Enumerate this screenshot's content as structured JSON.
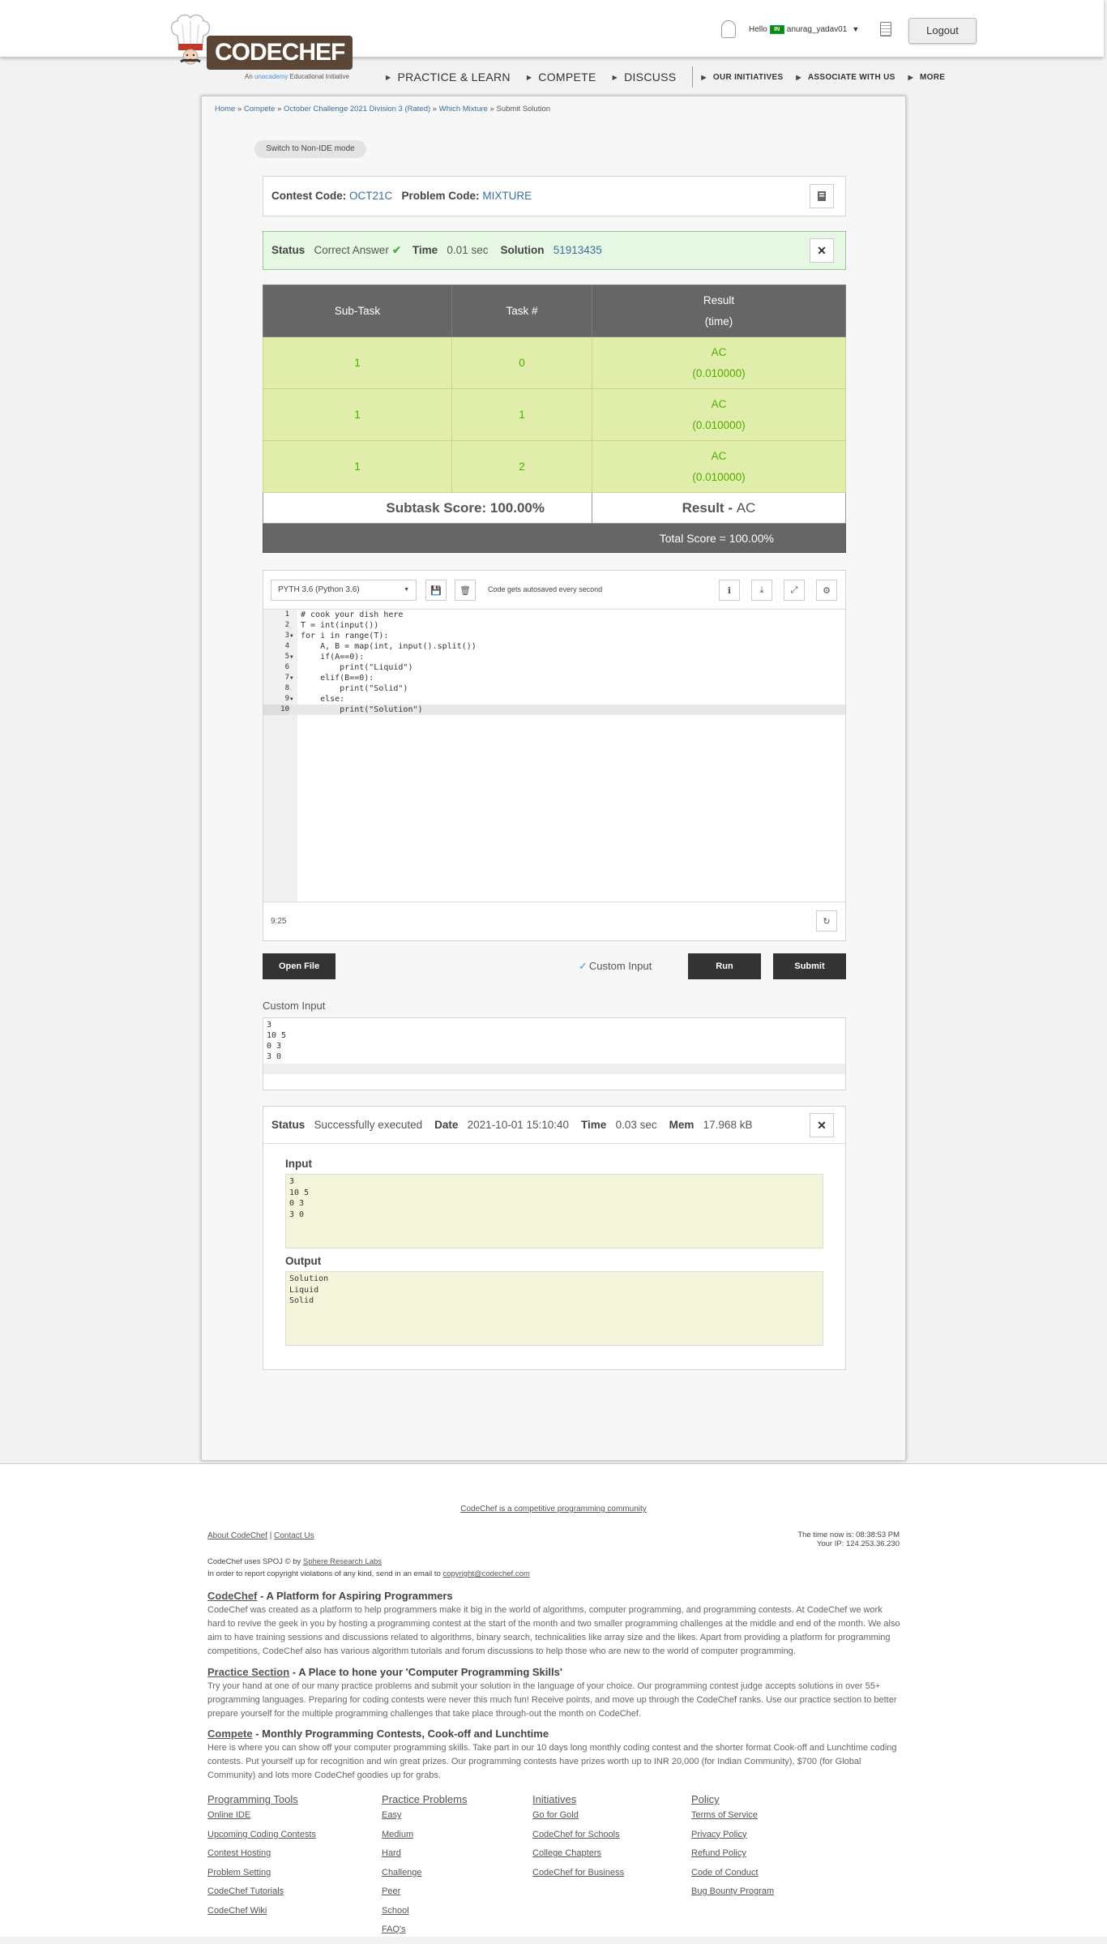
{
  "header": {
    "logo_text": "CODECHEF",
    "logo_tagline_prefix": "An",
    "logo_tagline_brand": "unacademy",
    "logo_tagline_suffix": "Educational Initiative",
    "greeting": "Hello",
    "flag": "IN",
    "username": "anurag_yadav01",
    "logout": "Logout"
  },
  "nav": {
    "items": [
      "PRACTICE & LEARN",
      "COMPETE",
      "DISCUSS"
    ],
    "small_items": [
      "OUR INITIATIVES",
      "ASSOCIATE WITH US",
      "MORE"
    ]
  },
  "breadcrumb": [
    "Home",
    "Compete",
    "October Challenge 2021 Division 3 (Rated)",
    "Which Mixture",
    "Submit Solution"
  ],
  "switch_mode": "Switch to Non-IDE mode",
  "problem": {
    "contest_label": "Contest Code:",
    "contest_code": "OCT21C",
    "problem_label": "Problem Code:",
    "problem_code": "MIXTURE"
  },
  "submission_status": {
    "status_label": "Status",
    "status": "Correct Answer",
    "time_label": "Time",
    "time": "0.01 sec",
    "solution_label": "Solution",
    "solution_id": "51913435"
  },
  "results": {
    "headers": [
      "Sub-Task",
      "Task #",
      "Result",
      "(time)"
    ],
    "rows": [
      {
        "subtask": "1",
        "task": "0",
        "result": "AC",
        "time": "(0.010000)"
      },
      {
        "subtask": "1",
        "task": "1",
        "result": "AC",
        "time": "(0.010000)"
      },
      {
        "subtask": "1",
        "task": "2",
        "result": "AC",
        "time": "(0.010000)"
      }
    ],
    "subtask_score": "Subtask Score: 100.00%",
    "result_label": "Result -",
    "result_value": "AC",
    "total_score": "Total Score = 100.00%"
  },
  "editor": {
    "language": "PYTH 3.6 (Python 3.6)",
    "autosave": "Code gets autosaved every second",
    "cursor_pos": "9:25",
    "lines": [
      "# cook your dish here",
      "T = int(input())",
      "for i in range(T):",
      "    A, B = map(int, input().split())",
      "    if(A==0):",
      "        print(\"Liquid\")",
      "    elif(B==0):",
      "        print(\"Solid\")",
      "    else:",
      "        print(\"Solution\")"
    ]
  },
  "actions": {
    "open_file": "Open File",
    "custom_input": "Custom Input",
    "run": "Run",
    "submit": "Submit"
  },
  "custom_input": {
    "label": "Custom Input",
    "value": "3\n10 5\n0 3\n3 0\n"
  },
  "run_result": {
    "status_label": "Status",
    "status": "Successfully executed",
    "date_label": "Date",
    "date": "2021-10-01 15:10:40",
    "time_label": "Time",
    "time": "0.03 sec",
    "mem_label": "Mem",
    "mem": "17.968 kB",
    "input_label": "Input",
    "input": "3\n10 5\n0 3\n3 0",
    "output_label": "Output",
    "output": "Solution\nLiquid\nSolid"
  },
  "footer": {
    "tagline": "CodeChef is a competitive programming community",
    "about": "About CodeChef",
    "contact": "Contact Us",
    "time_now": "The time now is: 08:38:53 PM",
    "your_ip": "Your IP: 124.253.36.230",
    "spoj_prefix": "CodeChef uses SPOJ © by",
    "spoj_link": "Sphere Research Labs",
    "copyright_prefix": "In order to report copyright violations of any kind, send in an email to",
    "copyright_email": "copyright@codechef.com",
    "sections": [
      {
        "title_link": "CodeChef",
        "title_rest": " - A Platform for Aspiring Programmers",
        "text": "CodeChef was created as a platform to help programmers make it big in the world of algorithms, computer programming, and programming contests. At CodeChef we work hard to revive the geek in you by hosting a programming contest at the start of the month and two smaller programming challenges at the middle and end of the month. We also aim to have training sessions and discussions related to algorithms, binary search, technicalities like array size and the likes. Apart from providing a platform for programming competitions, CodeChef also has various algorithm tutorials and forum discussions to help those who are new to the world of computer programming."
      },
      {
        "title_link": "Practice Section",
        "title_rest": " - A Place to hone your 'Computer Programming Skills'",
        "text": "Try your hand at one of our many practice problems and submit your solution in the language of your choice. Our programming contest judge accepts solutions in over 55+ programming languages. Preparing for coding contests were never this much fun! Receive points, and move up through the CodeChef ranks. Use our practice section to better prepare yourself for the multiple programming challenges that take place through-out the month on CodeChef."
      },
      {
        "title_link": "Compete",
        "title_rest": " - Monthly Programming Contests, Cook-off and Lunchtime",
        "text": "Here is where you can show off your computer programming skills. Take part in our 10 days long monthly coding contest and the shorter format Cook-off and Lunchtime coding contests. Put yourself up for recognition and win great prizes. Our programming contests have prizes worth up to INR 20,000 (for Indian Community), $700 (for Global Community) and lots more CodeChef goodies up for grabs."
      }
    ],
    "columns": [
      {
        "title": "Programming Tools",
        "links": [
          "Online IDE",
          "Upcoming Coding Contests",
          "Contest Hosting",
          "Problem Setting",
          "CodeChef Tutorials",
          "CodeChef Wiki"
        ]
      },
      {
        "title": "Practice Problems",
        "links": [
          "Easy",
          "Medium",
          "Hard",
          "Challenge",
          "Peer",
          "School",
          "FAQ's"
        ]
      },
      {
        "title": "Initiatives",
        "links": [
          "Go for Gold",
          "CodeChef for Schools",
          "College Chapters",
          "CodeChef for Business"
        ]
      },
      {
        "title": "Policy",
        "links": [
          "Terms of Service",
          "Privacy Policy",
          "Refund Policy",
          "Code of Conduct",
          "Bug Bounty Program"
        ]
      }
    ]
  }
}
